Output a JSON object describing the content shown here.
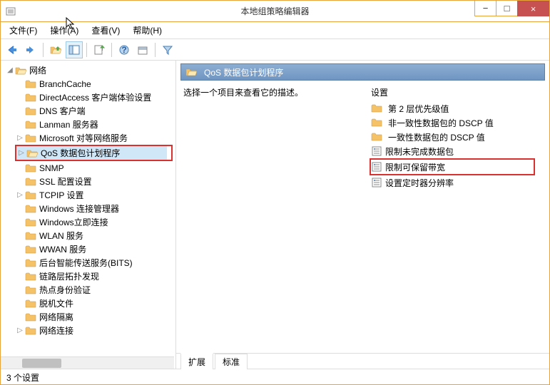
{
  "window": {
    "title": "本地组策略编辑器",
    "minimize": "−",
    "maximize": "□",
    "close": "×"
  },
  "menu": {
    "file": "文件(F)",
    "action": "操作(A)",
    "view": "查看(V)",
    "help": "帮助(H)"
  },
  "tree": {
    "root": "网络",
    "items": [
      "BranchCache",
      "DirectAccess 客户端体验设置",
      "DNS 客户端",
      "Lanman 服务器",
      "Microsoft 对等网络服务",
      "QoS 数据包计划程序",
      "SNMP",
      "SSL 配置设置",
      "TCPIP 设置",
      "Windows 连接管理器",
      "Windows立即连接",
      "WLAN 服务",
      "WWAN 服务",
      "后台智能传送服务(BITS)",
      "链路层拓扑发现",
      "热点身份验证",
      "脱机文件",
      "网络隔离",
      "网络连接"
    ]
  },
  "right": {
    "header": "QoS 数据包计划程序",
    "hint": "选择一个项目来查看它的描述。",
    "settings_header": "设置",
    "folders": [
      "第 2 层优先级值",
      "非一致性数据包的 DSCP 值",
      "一致性数据包的 DSCP 值"
    ],
    "settings": [
      "限制未完成数据包",
      "限制可保留带宽",
      "设置定时器分辨率"
    ],
    "tabs": {
      "extended": "扩展",
      "standard": "标准"
    }
  },
  "status": "3 个设置"
}
